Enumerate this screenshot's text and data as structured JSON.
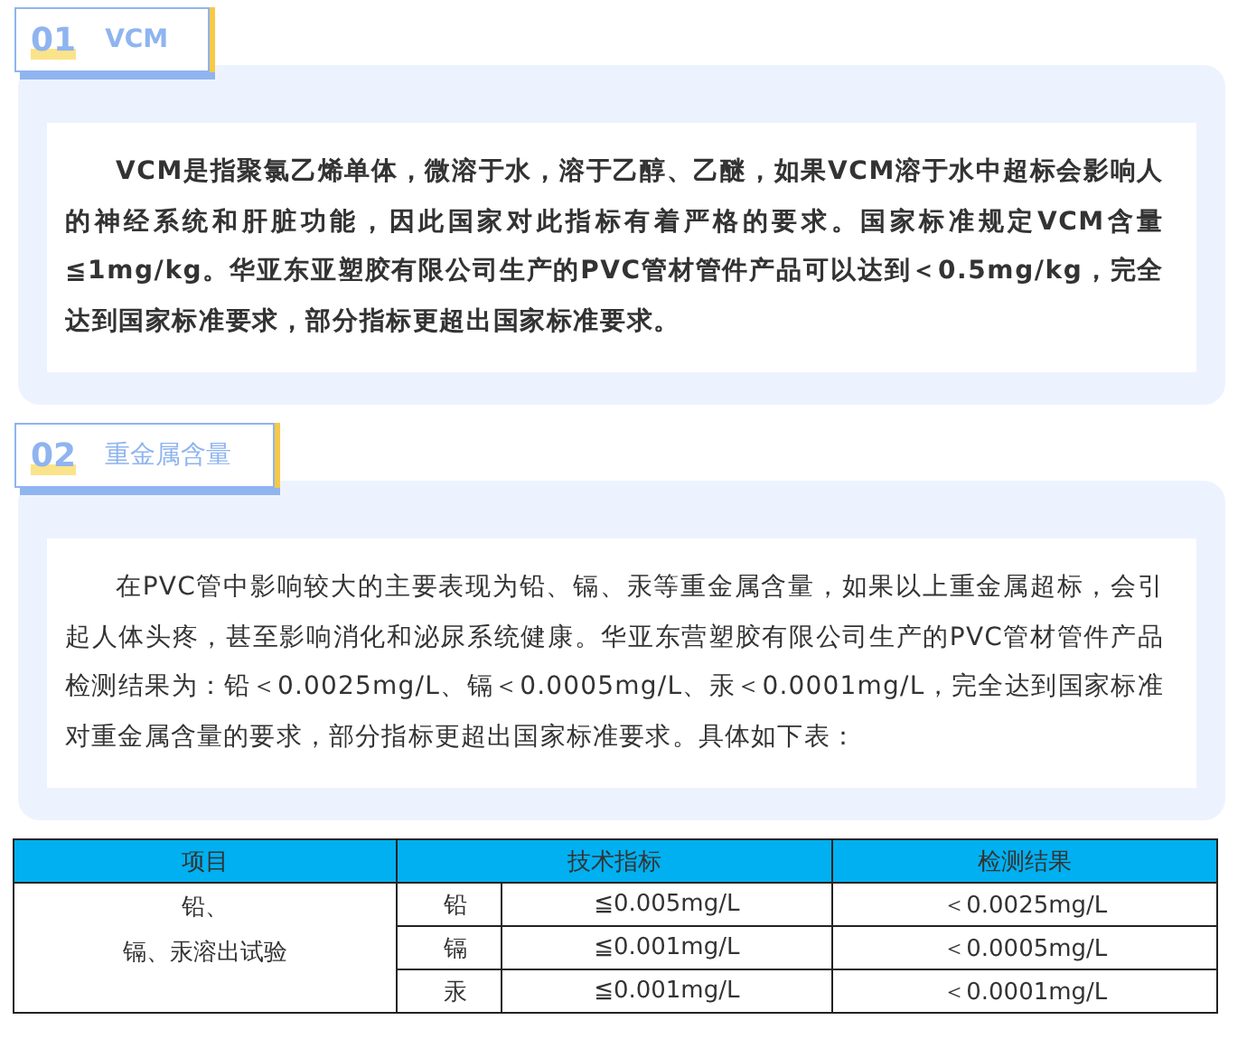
{
  "sections": [
    {
      "number": "01",
      "title": "VCM",
      "bold": true,
      "paragraph": "VCM是指聚氯乙烯单体，微溶于水，溶于乙醇、乙醚，如果VCM溶于水中超标会影响人的神经系统和肝脏功能，因此国家对此指标有着严格的要求。国家标准规定VCM含量≦1mg/kg。华亚东亚塑胶有限公司生产的PVC管材管件产品可以达到＜0.5mg/kg，完全达到国家标准要求，部分指标更超出国家标准要求。"
    },
    {
      "number": "02",
      "title": "重金属含量",
      "bold": false,
      "paragraph": "在PVC管中影响较大的主要表现为铅、镉、汞等重金属含量，如果以上重金属超标，会引起人体头疼，甚至影响消化和泌尿系统健康。华亚东营塑胶有限公司生产的PVC管材管件产品检测结果为：铅＜0.0025mg/L、镉＜0.0005mg/L、汞＜0.0001mg/L，完全达到国家标准对重金属含量的要求，部分指标更超出国家标准要求。具体如下表："
    }
  ],
  "table": {
    "columns": [
      "项目",
      "技术指标",
      "检测结果"
    ],
    "item_lines": [
      "铅、",
      "镉、汞溶出试验"
    ],
    "rows": [
      {
        "element": "铅",
        "standard": "≦0.005mg/L",
        "result": "＜0.0025mg/L"
      },
      {
        "element": "镉",
        "standard": "≦0.001mg/L",
        "result": "＜0.0005mg/L"
      },
      {
        "element": "汞",
        "standard": "≦0.001mg/L",
        "result": "＜0.0001mg/L"
      }
    ]
  }
}
